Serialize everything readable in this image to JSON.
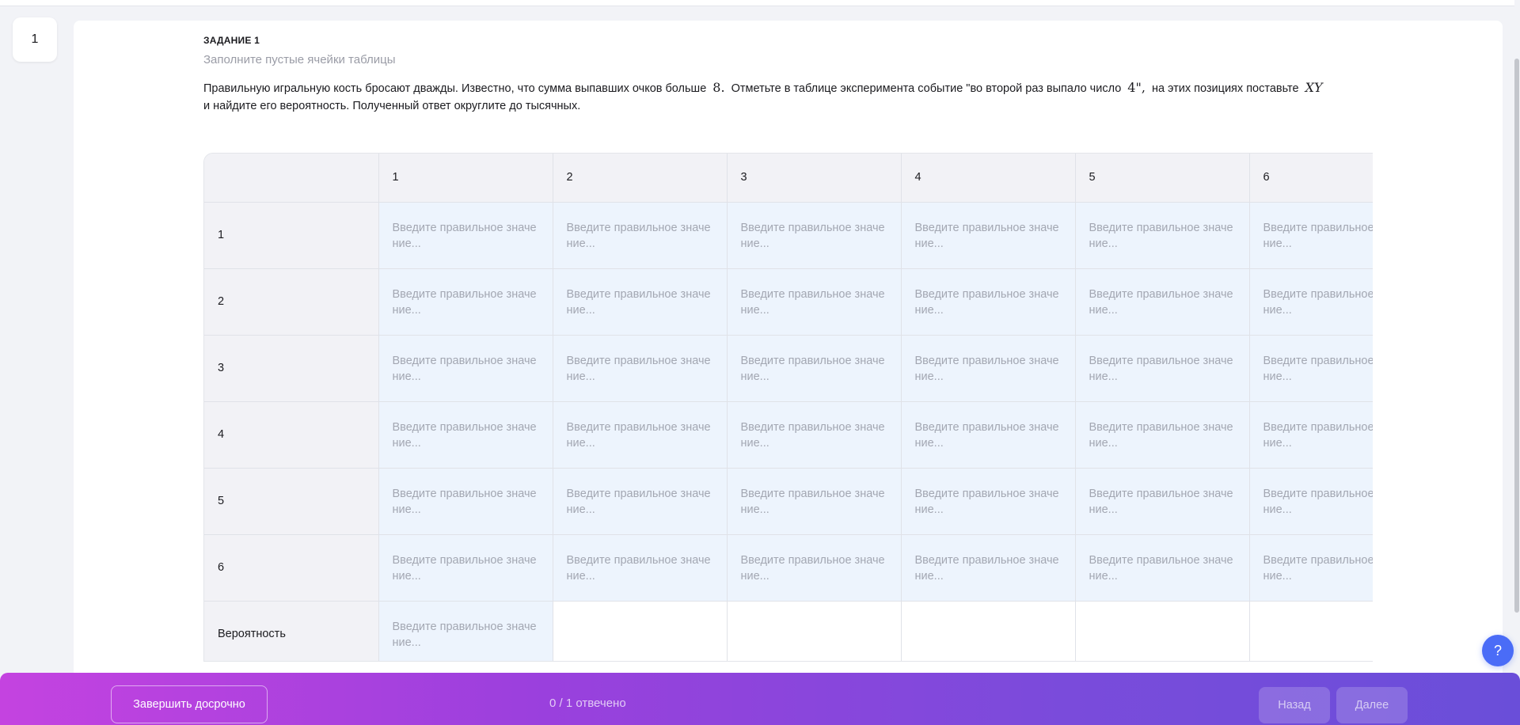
{
  "task_nav": {
    "number": "1"
  },
  "task": {
    "heading": "ЗАДАНИЕ 1",
    "subtitle": "Заполните пустые ячейки таблицы",
    "text_part1": "Правильную игральную кость бросают дважды. Известно, что сумма выпавших очков больше",
    "math_sum": "8.",
    "text_part2": "Отметьте в таблице эксперимента событие \"во второй раз выпало число",
    "math_number": "4\",",
    "text_part3": "на этих позициях поставьте",
    "math_mark": "XY",
    "text_part4": "и найдите его вероятность. Полученный ответ округлите до тысячных."
  },
  "table": {
    "column_headers": [
      "1",
      "2",
      "3",
      "4",
      "5",
      "6"
    ],
    "row_labels": [
      "1",
      "2",
      "3",
      "4",
      "5",
      "6"
    ],
    "probability_label": "Вероятность",
    "cell_placeholder": "Введите правильное значение..."
  },
  "help": {
    "label": "?"
  },
  "footer": {
    "finish_label": "Завершить досрочно",
    "answered_status": "0 / 1 отвечено",
    "back_label": "Назад",
    "next_label": "Далее"
  },
  "colors": {
    "accent_gradient_start": "#c443e0",
    "accent_gradient_end": "#6a4ed9",
    "input_cell_bg": "#edf4fd",
    "header_cell_bg": "#f2f2f6",
    "help_button": "#4a6cf7"
  }
}
